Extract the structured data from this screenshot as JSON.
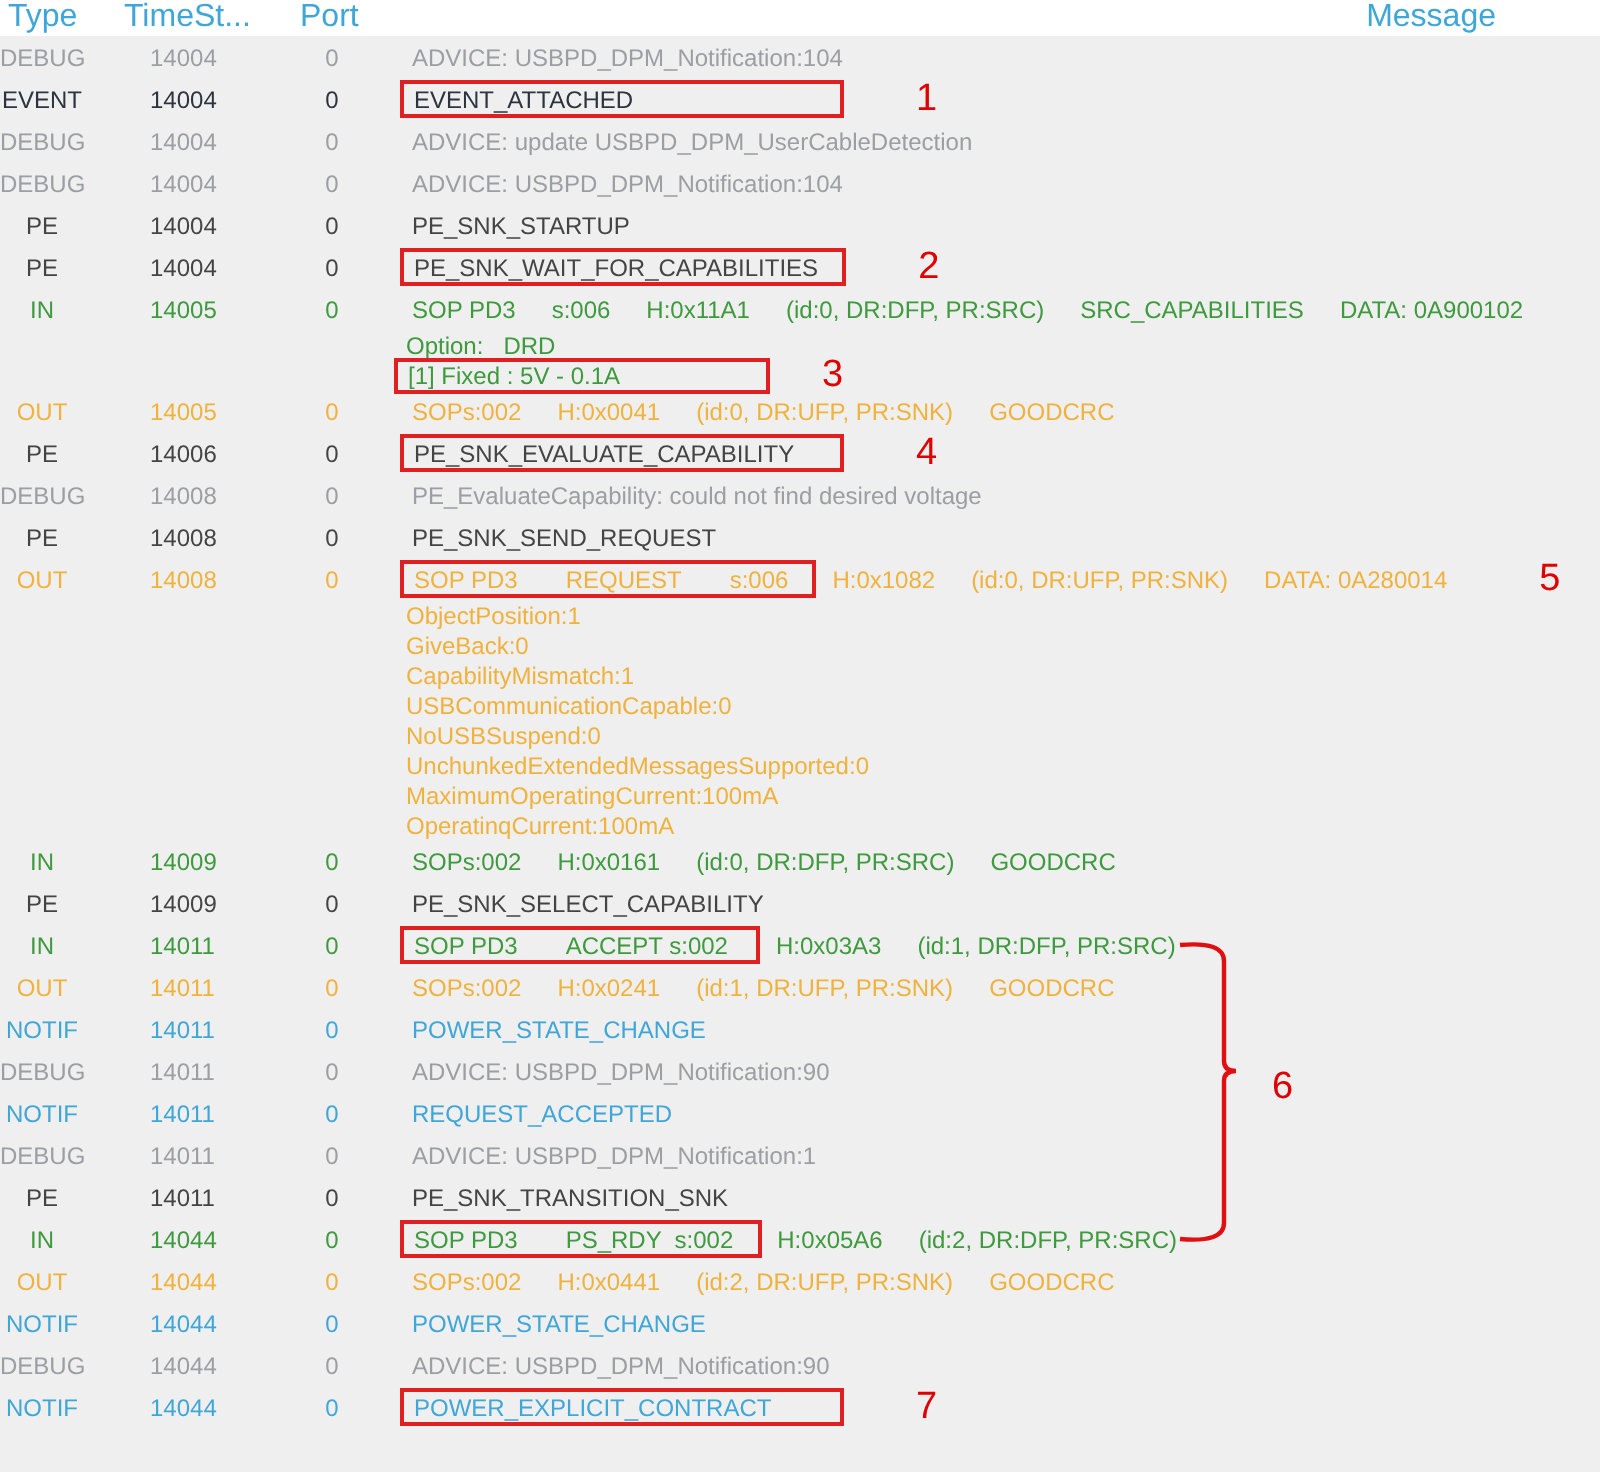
{
  "columns": [
    "Type",
    "TimeSt...",
    "Port",
    "Message"
  ],
  "rows": [
    {
      "kind": "debug",
      "type": "DEBUG",
      "time": "14004",
      "port": "0",
      "segments": [
        "ADVICE: USBPD_DPM_Notification:104"
      ],
      "in_bracket": false
    },
    {
      "kind": "event",
      "type": "EVENT",
      "time": "14004",
      "port": "0",
      "boxed": [
        "EVENT_ATTACHED"
      ],
      "callout": "1",
      "in_bracket": false
    },
    {
      "kind": "debug",
      "type": "DEBUG",
      "time": "14004",
      "port": "0",
      "segments": [
        "ADVICE: update USBPD_DPM_UserCableDetection"
      ],
      "in_bracket": false
    },
    {
      "kind": "debug",
      "type": "DEBUG",
      "time": "14004",
      "port": "0",
      "segments": [
        "ADVICE: USBPD_DPM_Notification:104"
      ],
      "in_bracket": false
    },
    {
      "kind": "pe",
      "type": "PE",
      "time": "14004",
      "port": "0",
      "segments": [
        "PE_SNK_STARTUP"
      ],
      "in_bracket": false
    },
    {
      "kind": "pe",
      "type": "PE",
      "time": "14004",
      "port": "0",
      "boxed": [
        "PE_SNK_WAIT_FOR_CAPABILITIES"
      ],
      "callout": "2",
      "in_bracket": false
    },
    {
      "kind": "in",
      "type": "IN",
      "time": "14005",
      "port": "0",
      "segments": [
        "SOP PD3",
        "s:006",
        "H:0x11A1",
        "(id:0, DR:DFP, PR:SRC)",
        "SRC_CAPABILITIES",
        "DATA: 0A900102"
      ],
      "lines": [
        {
          "text": "Option:   DRD",
          "boxed": false
        },
        {
          "text": "[1] Fixed : 5V - 0.1A",
          "boxed": true,
          "callout": "3"
        }
      ],
      "in_bracket": false
    },
    {
      "kind": "out",
      "type": "OUT",
      "time": "14005",
      "port": "0",
      "segments": [
        "SOPs:002",
        "H:0x0041",
        "(id:0, DR:UFP, PR:SNK)",
        "GOODCRC"
      ],
      "in_bracket": false
    },
    {
      "kind": "pe",
      "type": "PE",
      "time": "14006",
      "port": "0",
      "boxed": [
        "PE_SNK_EVALUATE_CAPABILITY"
      ],
      "callout": "4",
      "in_bracket": false
    },
    {
      "kind": "debug",
      "type": "DEBUG",
      "time": "14008",
      "port": "0",
      "segments": [
        "PE_EvaluateCapability: could not find desired voltage"
      ],
      "in_bracket": false
    },
    {
      "kind": "pe",
      "type": "PE",
      "time": "14008",
      "port": "0",
      "segments": [
        "PE_SNK_SEND_REQUEST"
      ],
      "in_bracket": false
    },
    {
      "kind": "out",
      "type": "OUT",
      "time": "14008",
      "port": "0",
      "boxed": [
        "SOP PD3",
        "REQUEST",
        "s:006"
      ],
      "segments": [
        "H:0x1082",
        "(id:0, DR:UFP, PR:SNK)",
        "DATA: 0A280014"
      ],
      "callout": "5",
      "lines": [
        {
          "text": "ObjectPosition:1",
          "boxed": false
        },
        {
          "text": "GiveBack:0",
          "boxed": false
        },
        {
          "text": "CapabilityMismatch:1",
          "boxed": false
        },
        {
          "text": "USBCommunicationCapable:0",
          "boxed": false
        },
        {
          "text": "NoUSBSuspend:0",
          "boxed": false
        },
        {
          "text": "UnchunkedExtendedMessagesSupported:0",
          "boxed": false
        },
        {
          "text": "MaximumOperatingCurrent:100mA",
          "boxed": false
        },
        {
          "text": "OperatinqCurrent:100mA",
          "boxed": false
        }
      ],
      "in_bracket": false
    },
    {
      "kind": "in",
      "type": "IN",
      "time": "14009",
      "port": "0",
      "segments": [
        "SOPs:002",
        "H:0x0161",
        "(id:0, DR:DFP, PR:SRC)",
        "GOODCRC"
      ],
      "in_bracket": false
    },
    {
      "kind": "pe",
      "type": "PE",
      "time": "14009",
      "port": "0",
      "segments": [
        "PE_SNK_SELECT_CAPABILITY"
      ],
      "in_bracket": false
    },
    {
      "kind": "in",
      "type": "IN",
      "time": "14011",
      "port": "0",
      "boxed": [
        "SOP PD3",
        "ACCEPT s:002"
      ],
      "segments": [
        "H:0x03A3",
        "(id:1, DR:DFP, PR:SRC)"
      ],
      "in_bracket": true
    },
    {
      "kind": "out",
      "type": "OUT",
      "time": "14011",
      "port": "0",
      "segments": [
        "SOPs:002",
        "H:0x0241",
        "(id:1, DR:UFP, PR:SNK)",
        "GOODCRC"
      ],
      "in_bracket": true
    },
    {
      "kind": "notif",
      "type": "NOTIF",
      "time": "14011",
      "port": "0",
      "segments": [
        "POWER_STATE_CHANGE"
      ],
      "in_bracket": true
    },
    {
      "kind": "debug",
      "type": "DEBUG",
      "time": "14011",
      "port": "0",
      "segments": [
        "ADVICE: USBPD_DPM_Notification:90"
      ],
      "in_bracket": true
    },
    {
      "kind": "notif",
      "type": "NOTIF",
      "time": "14011",
      "port": "0",
      "segments": [
        "REQUEST_ACCEPTED"
      ],
      "in_bracket": true
    },
    {
      "kind": "debug",
      "type": "DEBUG",
      "time": "14011",
      "port": "0",
      "segments": [
        "ADVICE: USBPD_DPM_Notification:1"
      ],
      "in_bracket": true
    },
    {
      "kind": "pe",
      "type": "PE",
      "time": "14011",
      "port": "0",
      "segments": [
        "PE_SNK_TRANSITION_SNK"
      ],
      "in_bracket": true
    },
    {
      "kind": "in",
      "type": "IN",
      "time": "14044",
      "port": "0",
      "boxed": [
        "SOP PD3",
        "PS_RDY  s:002"
      ],
      "segments": [
        "H:0x05A6",
        "(id:2, DR:DFP, PR:SRC)"
      ],
      "in_bracket": true
    },
    {
      "kind": "out",
      "type": "OUT",
      "time": "14044",
      "port": "0",
      "segments": [
        "SOPs:002",
        "H:0x0441",
        "(id:2, DR:UFP, PR:SNK)",
        "GOODCRC"
      ],
      "in_bracket": false
    },
    {
      "kind": "notif",
      "type": "NOTIF",
      "time": "14044",
      "port": "0",
      "segments": [
        "POWER_STATE_CHANGE"
      ],
      "in_bracket": false
    },
    {
      "kind": "debug",
      "type": "DEBUG",
      "time": "14044",
      "port": "0",
      "segments": [
        "ADVICE: USBPD_DPM_Notification:90"
      ],
      "in_bracket": false
    },
    {
      "kind": "notif",
      "type": "NOTIF",
      "time": "14044",
      "port": "0",
      "boxed": [
        "POWER_EXPLICIT_CONTRACT"
      ],
      "callout": "7",
      "in_bracket": false
    }
  ],
  "bracket": {
    "label": "6"
  }
}
